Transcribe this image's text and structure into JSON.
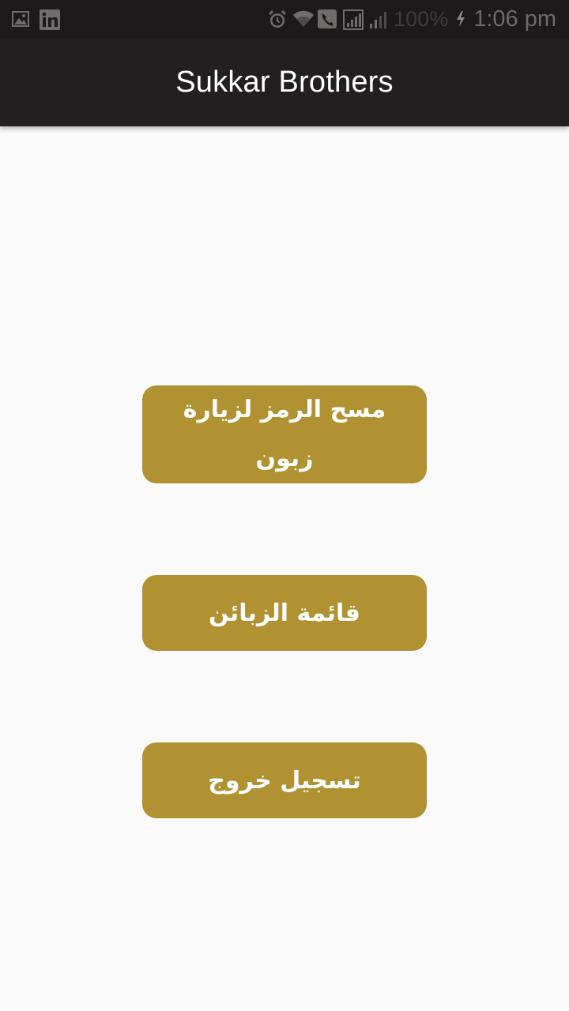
{
  "status_bar": {
    "left_icons": [
      "image-icon",
      "linkedin-icon"
    ],
    "right_icons": [
      "alarm-icon",
      "wifi-icon",
      "call-icon",
      "signal-icon",
      "signal-weak-icon"
    ],
    "battery_percent": "100%",
    "charging_icon": "charging-bolt-icon",
    "time": "1:06 pm"
  },
  "app_bar": {
    "title": "Sukkar Brothers"
  },
  "buttons": {
    "scan_label": "مسح الرمز لزيارة زبون",
    "customers_label": "قائمة الزبائن",
    "logout_label": "تسجيل خروج"
  },
  "colors": {
    "app_bar": "#231f20",
    "status_bar": "#1b1919",
    "button": "#b09232",
    "background": "#fafafa"
  }
}
